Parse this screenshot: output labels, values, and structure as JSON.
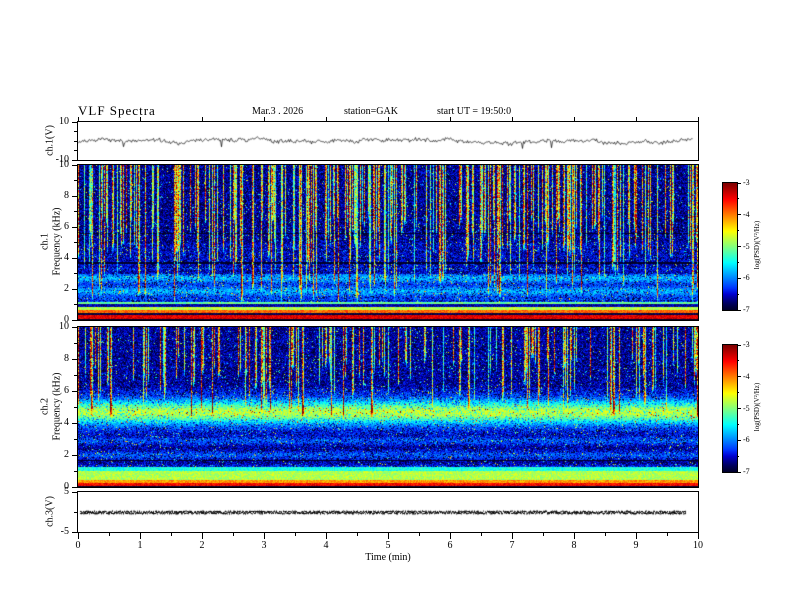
{
  "title": "VLF Spectra",
  "header": {
    "date": "Mar.3 . 2026",
    "station": "station=GAK",
    "start_ut": "start UT =  19:50:0"
  },
  "xaxis": {
    "label": "Time (min)",
    "ticks": [
      0,
      1,
      2,
      3,
      4,
      5,
      6,
      7,
      8,
      9,
      10
    ],
    "range": [
      0,
      10
    ]
  },
  "yticks": {
    "p1": [
      "10",
      "-10"
    ],
    "p2": [
      "10",
      "8",
      "6",
      "4",
      "2",
      "0"
    ],
    "p3": [
      "10",
      "8",
      "6",
      "4",
      "2",
      "0"
    ],
    "p4": [
      "5",
      "-5"
    ]
  },
  "panels": {
    "p1": {
      "ylabel": "ch.1(V)",
      "ylim": [
        -10,
        10
      ]
    },
    "p2": {
      "ylabel_ch": "ch.1",
      "ylabel_freq": "Frequency (kHz)",
      "ylim": [
        0,
        10
      ]
    },
    "p3": {
      "ylabel_ch": "ch.2",
      "ylabel_freq": "Frequency (kHz)",
      "ylim": [
        0,
        10
      ]
    },
    "p4": {
      "ylabel": "ch.3(V)",
      "ylim": [
        -5,
        5
      ]
    }
  },
  "colorbar": {
    "label": "log(PSD)(V²/Hz)",
    "ticks": [
      -3,
      -4,
      -5,
      -6,
      -7
    ],
    "range": [
      -7,
      -3
    ]
  },
  "chart_data": [
    {
      "type": "line",
      "name": "ch.1 waveform",
      "xlabel": "Time (min)",
      "xlim": [
        0,
        10
      ],
      "ylabel": "ch.1(V)",
      "ylim": [
        -10,
        10
      ],
      "yticks": [
        10,
        -10
      ],
      "series": [
        {
          "name": "ch.1 voltage",
          "summary": "continuous noisy black trace fluctuating about 0 V with roughly ±2 V excursions and occasional brief negative spikes across the full 0-10 min window"
        }
      ]
    },
    {
      "type": "heatmap",
      "name": "ch.1 spectrogram",
      "xlabel": "Time (min)",
      "xlim": [
        0,
        10
      ],
      "ylabel": "Frequency (kHz)",
      "ylim": [
        0,
        10
      ],
      "yticks": [
        0,
        2,
        4,
        6,
        8,
        10
      ],
      "zlabel": "log(PSD)(V²/Hz)",
      "zlim": [
        -7,
        -3
      ],
      "legend_position": "right colorbar",
      "features": [
        "blue broadband noise floor near -6 to -6.5",
        "dense vertical sferic bursts (cyan/green/yellow/red, up to -3) strongest from 10 kHz down to ~5 kHz, many penetrating lower",
        "narrow dark horizontal line near 3.7 kHz",
        "intense layered bands below ~1.2 kHz: black edge, red band (~-3.5), yellow-orange band (~-4), green lines (~-5)"
      ]
    },
    {
      "type": "heatmap",
      "name": "ch.2 spectrogram",
      "xlabel": "Time (min)",
      "xlim": [
        0,
        10
      ],
      "ylabel": "Frequency (kHz)",
      "ylim": [
        0,
        10
      ],
      "yticks": [
        0,
        2,
        4,
        6,
        8,
        10
      ],
      "zlabel": "log(PSD)(V²/Hz)",
      "zlim": [
        -7,
        -3
      ],
      "legend_position": "right colorbar",
      "features": [
        "vertical sferic bursts mostly confined above ~6 kHz",
        "diffuse cyan-green emission band near 4-5.5 kHz persisting the whole interval",
        "blue noise floor with faint horizontal banding below 3 kHz",
        "layered red/yellow/green bands below ~1.2 kHz"
      ]
    },
    {
      "type": "line",
      "name": "ch.3 waveform",
      "xlabel": "Time (min)",
      "xlim": [
        0,
        10
      ],
      "ylabel": "ch.3(V)",
      "ylim": [
        -5,
        5
      ],
      "yticks": [
        5,
        -5
      ],
      "series": [
        {
          "name": "ch.3 voltage",
          "summary": "dense flat dark dotted trace pinned at 0 V, ending slightly before 10 min"
        }
      ]
    }
  ]
}
